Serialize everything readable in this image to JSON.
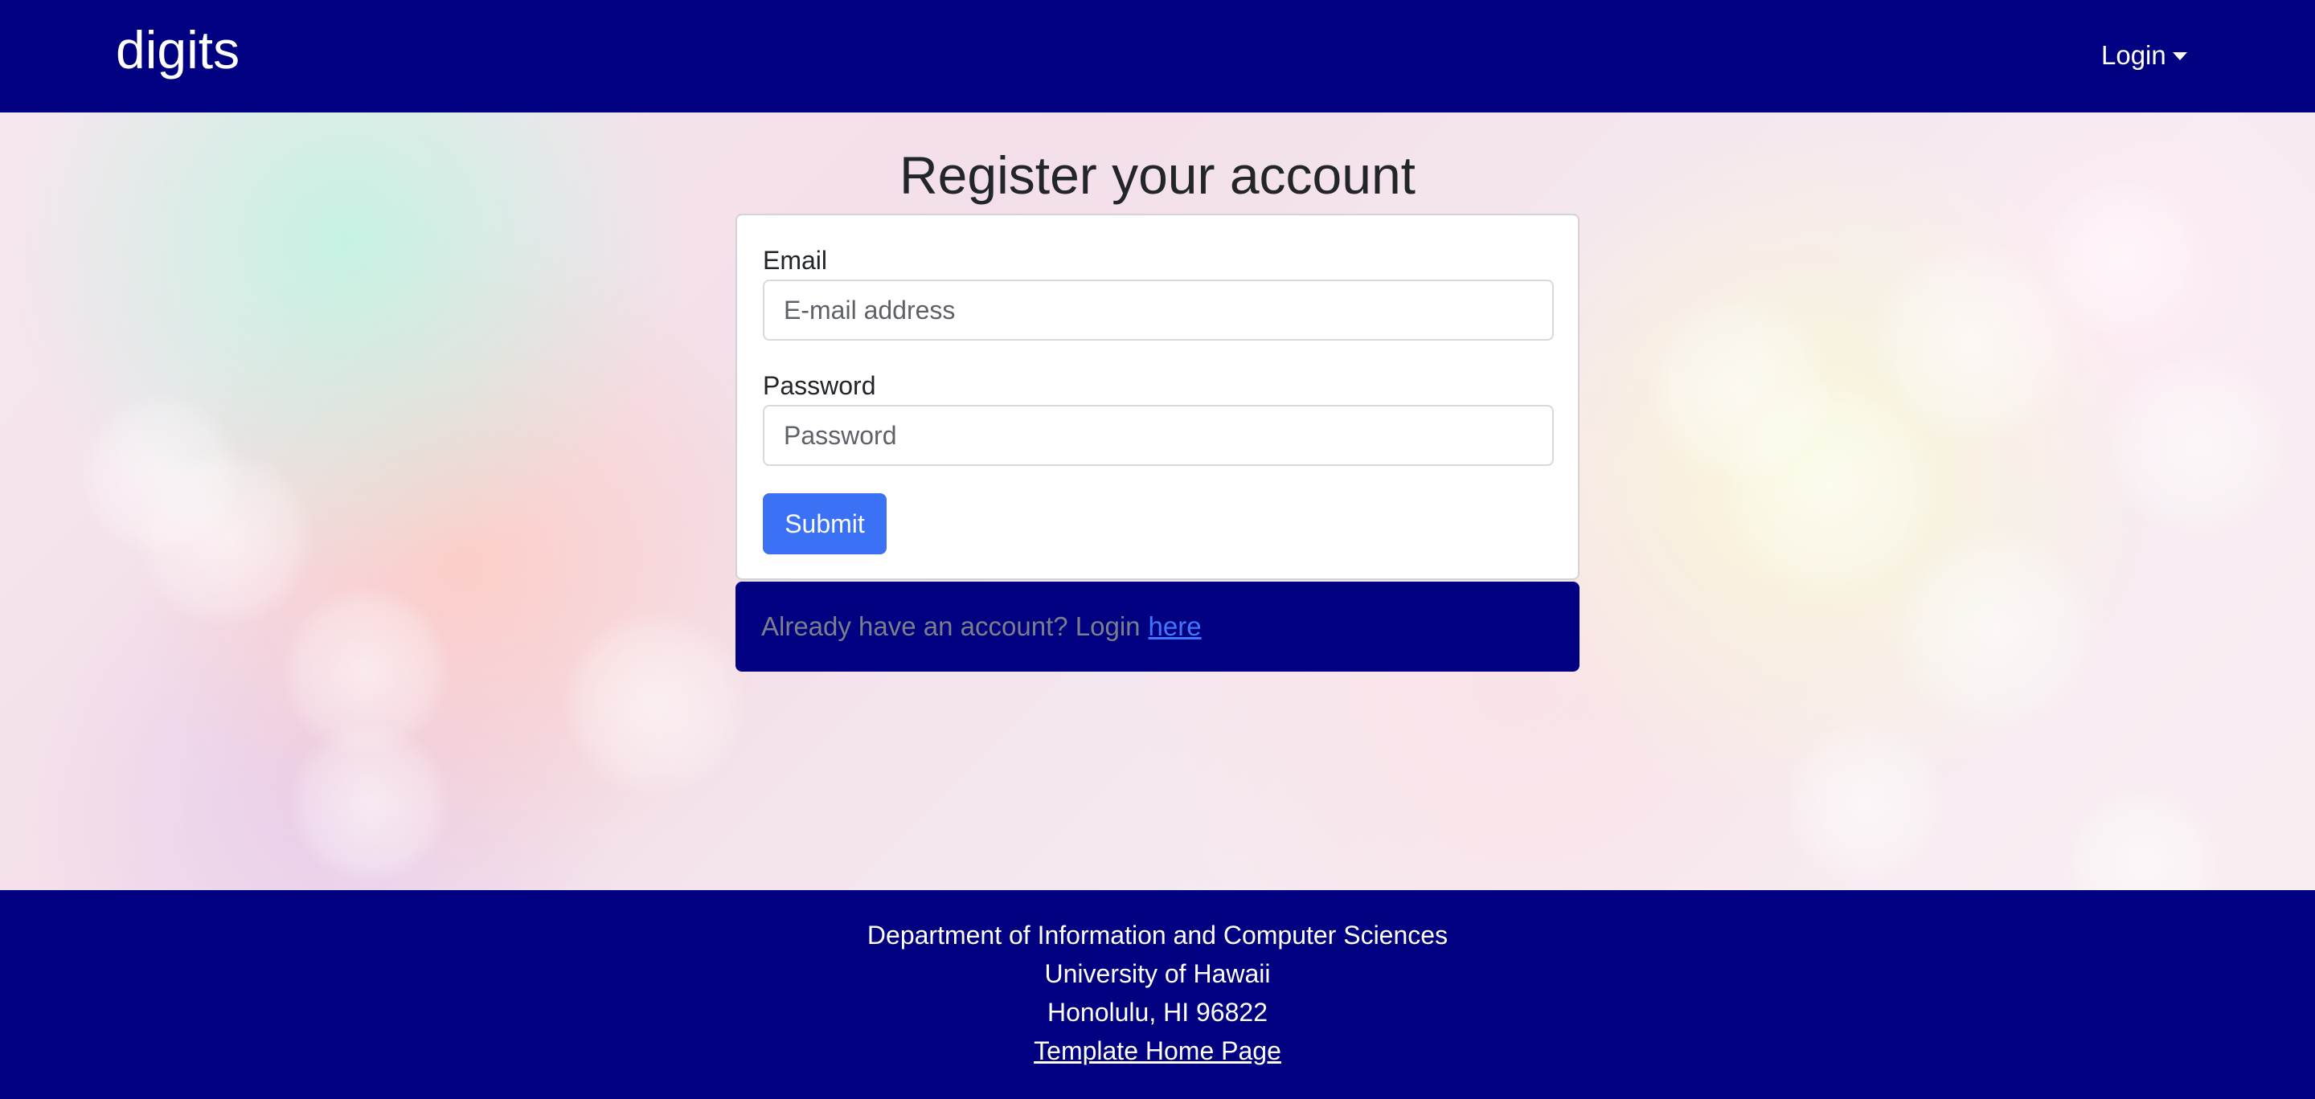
{
  "navbar": {
    "brand": "digits",
    "login_label": "Login"
  },
  "page": {
    "title": "Register your account"
  },
  "form": {
    "email_label": "Email",
    "email_placeholder": "E-mail address",
    "password_label": "Password",
    "password_placeholder": "Password",
    "submit_label": "Submit"
  },
  "login_prompt": {
    "text": "Already have an account? Login",
    "link_text": "here"
  },
  "footer": {
    "line1": "Department of Information and Computer Sciences",
    "line2": "University of Hawaii",
    "line3": "Honolulu, HI 96822",
    "link_text": "Template Home Page"
  },
  "colors": {
    "navbar_bg": "#000080",
    "primary_button": "#3b71f5",
    "link": "#3d78ff"
  }
}
